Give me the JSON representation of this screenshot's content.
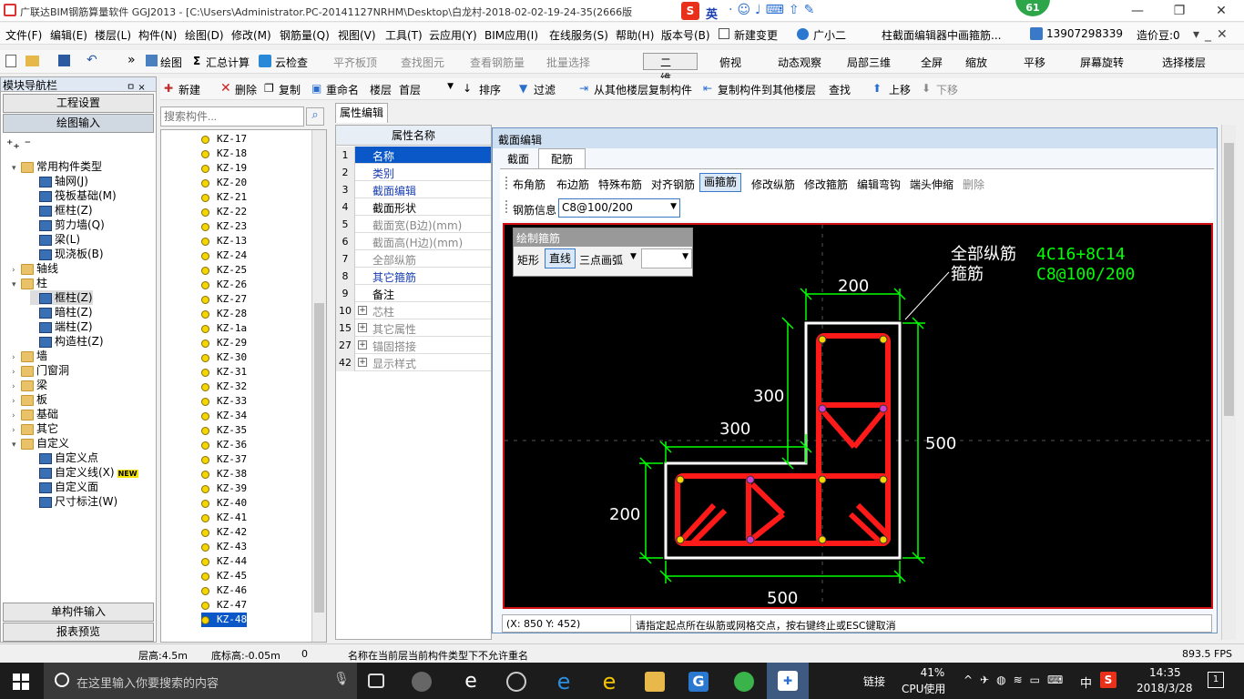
{
  "window": {
    "title": "广联达BIM钢筋算量软件 GGJ2013 - [C:\\Users\\Administrator.PC-20141127NRHM\\Desktop\\白龙村-2018-02-02-19-24-35(2666版",
    "ime_label": "英",
    "badge": "61",
    "min": "—",
    "max": "❐",
    "close": "✕"
  },
  "menu": [
    "文件(F)",
    "编辑(E)",
    "楼层(L)",
    "构件(N)",
    "绘图(D)",
    "修改(M)",
    "钢筋量(Q)",
    "视图(V)",
    "工具(T)",
    "云应用(Y)",
    "BIM应用(I)",
    "在线服务(S)",
    "帮助(H)",
    "版本号(B)",
    "新建变更",
    "广小二",
    "柱截面编辑器中画箍筋...",
    "13907298339",
    "造价豆:0"
  ],
  "toolbar1": {
    "draw": "绘图",
    "sum": "汇总计算",
    "cloud": "云检查",
    "flat": "平齐板顶",
    "find": "查找图元",
    "view_rebar": "查看钢筋量",
    "batch": "批量选择",
    "view_mode": "二维",
    "top_view": "俯视",
    "dynamic": "动态观察",
    "local3d": "局部三维",
    "fullscreen": "全屏",
    "zoom": "缩放",
    "pan": "平移",
    "rotate": "屏幕旋转",
    "sel_floor": "选择楼层"
  },
  "toolbar2": {
    "new": "新建",
    "delete": "删除",
    "copy": "复制",
    "rename": "重命名",
    "floor_label": "楼层",
    "floor_value": "首层",
    "sort": "排序",
    "filter": "过滤",
    "copy_from": "从其他楼层复制构件",
    "copy_to": "复制构件到其他楼层",
    "find": "查找",
    "up": "上移",
    "down": "下移"
  },
  "nav": {
    "header": "模块导航栏",
    "pin": "ㅁ ×",
    "setup": "工程设置",
    "draw_input": "绘图输入",
    "single": "单构件输入",
    "report": "报表预览",
    "tree": [
      {
        "exp": "▾",
        "icon": "folder",
        "label": "常用构件类型",
        "indent": 0
      },
      {
        "exp": "",
        "icon": "blue",
        "label": "轴网(J)",
        "indent": 2
      },
      {
        "exp": "",
        "icon": "blue",
        "label": "筏板基础(M)",
        "indent": 2
      },
      {
        "exp": "",
        "icon": "blue",
        "label": "框柱(Z)",
        "indent": 2
      },
      {
        "exp": "",
        "icon": "blue",
        "label": "剪力墙(Q)",
        "indent": 2
      },
      {
        "exp": "",
        "icon": "blue",
        "label": "梁(L)",
        "indent": 2
      },
      {
        "exp": "",
        "icon": "blue",
        "label": "现浇板(B)",
        "indent": 2
      },
      {
        "exp": "›",
        "icon": "folder",
        "label": "轴线",
        "indent": 0
      },
      {
        "exp": "▾",
        "icon": "folder",
        "label": "柱",
        "indent": 0
      },
      {
        "exp": "",
        "icon": "blue",
        "label": "框柱(Z)",
        "indent": 2,
        "sel": true
      },
      {
        "exp": "",
        "icon": "blue",
        "label": "暗柱(Z)",
        "indent": 2
      },
      {
        "exp": "",
        "icon": "blue",
        "label": "端柱(Z)",
        "indent": 2
      },
      {
        "exp": "",
        "icon": "blue",
        "label": "构造柱(Z)",
        "indent": 2
      },
      {
        "exp": "›",
        "icon": "folder",
        "label": "墙",
        "indent": 0
      },
      {
        "exp": "›",
        "icon": "folder",
        "label": "门窗洞",
        "indent": 0
      },
      {
        "exp": "›",
        "icon": "folder",
        "label": "梁",
        "indent": 0
      },
      {
        "exp": "›",
        "icon": "folder",
        "label": "板",
        "indent": 0
      },
      {
        "exp": "›",
        "icon": "folder",
        "label": "基础",
        "indent": 0
      },
      {
        "exp": "›",
        "icon": "folder",
        "label": "其它",
        "indent": 0
      },
      {
        "exp": "▾",
        "icon": "folder",
        "label": "自定义",
        "indent": 0
      },
      {
        "exp": "",
        "icon": "blue",
        "label": "自定义点",
        "indent": 2
      },
      {
        "exp": "",
        "icon": "blue",
        "label": "自定义线(X)",
        "indent": 2,
        "new": "NEW"
      },
      {
        "exp": "",
        "icon": "blue",
        "label": "自定义面",
        "indent": 2
      },
      {
        "exp": "",
        "icon": "blue",
        "label": "尺寸标注(W)",
        "indent": 2
      }
    ]
  },
  "search_placeholder": "搜索构件...",
  "components": [
    "KZ-17",
    "KZ-18",
    "KZ-19",
    "KZ-20",
    "KZ-21",
    "KZ-22",
    "KZ-23",
    "KZ-13",
    "KZ-24",
    "KZ-25",
    "KZ-26",
    "KZ-27",
    "KZ-28",
    "KZ-1a",
    "KZ-29",
    "KZ-30",
    "KZ-31",
    "KZ-32",
    "KZ-33",
    "KZ-34",
    "KZ-35",
    "KZ-36",
    "KZ-37",
    "KZ-38",
    "KZ-39",
    "KZ-40",
    "KZ-41",
    "KZ-42",
    "KZ-43",
    "KZ-44",
    "KZ-45",
    "KZ-46",
    "KZ-47",
    "KZ-48"
  ],
  "selected_component": "KZ-48",
  "props": {
    "tab": "属性编辑",
    "header": "属性名称",
    "rows": [
      {
        "num": "1",
        "label": "名称",
        "color": "#1a3fb0",
        "sel": true
      },
      {
        "num": "2",
        "label": "类别",
        "color": "#1a3fb0"
      },
      {
        "num": "3",
        "label": "截面编辑",
        "color": "#1a3fb0"
      },
      {
        "num": "4",
        "label": "截面形状",
        "color": "#000"
      },
      {
        "num": "5",
        "label": "截面宽(B边)(mm)",
        "color": "#888"
      },
      {
        "num": "6",
        "label": "截面高(H边)(mm)",
        "color": "#888"
      },
      {
        "num": "7",
        "label": "全部纵筋",
        "color": "#888"
      },
      {
        "num": "8",
        "label": "其它箍筋",
        "color": "#1a3fb0"
      },
      {
        "num": "9",
        "label": "备注",
        "color": "#000"
      },
      {
        "num": "10",
        "label": "芯柱",
        "color": "#888",
        "plus": true
      },
      {
        "num": "15",
        "label": "其它属性",
        "color": "#888",
        "plus": true
      },
      {
        "num": "27",
        "label": "锚固搭接",
        "color": "#888",
        "plus": true
      },
      {
        "num": "42",
        "label": "显示样式",
        "color": "#888",
        "plus": true
      }
    ]
  },
  "dialog": {
    "title": "截面编辑",
    "tabs": [
      "截面",
      "配筋"
    ],
    "tools": [
      "布角筋",
      "布边筋",
      "特殊布筋",
      "对齐钢筋",
      "画箍筋",
      "修改纵筋",
      "修改箍筋",
      "编辑弯钩",
      "端头伸缩",
      "删除"
    ],
    "rebar_label": "钢筋信息",
    "rebar_value": "C8@100/200",
    "draw_panel": {
      "title": "绘制箍筋",
      "rect": "矩形",
      "line": "直线",
      "arc": "三点画弧"
    },
    "canvas": {
      "label_long": "全部纵筋",
      "long_value": "4C16+8C14",
      "label_stirrup": "箍筋",
      "stirrup_value": "C8@100/200",
      "dims": {
        "top": "200",
        "left_upper": "300",
        "mid": "300",
        "right": "500",
        "left_lower": "200",
        "bottom": "500"
      }
    },
    "coords": "(X: 850 Y: 452)",
    "hint": "请指定起点所在纵筋或网格交点，按右键终止或ESC键取消"
  },
  "status": {
    "floor_height": "层高:4.5m",
    "base_height": "底标高:-0.05m",
    "zero": "0",
    "msg": "名称在当前层当前构件类型下不允许重名",
    "fps": "893.5 FPS"
  },
  "taskbar": {
    "search": "在这里输入你要搜索的内容",
    "link": "链接",
    "cpu": "41%",
    "cpu_label": "CPU使用",
    "time": "14:35",
    "date": "2018/3/28",
    "lang": "中",
    "notify": "1"
  },
  "colors": {
    "rebar": "#ff1a1a",
    "dim": "#00ff00",
    "outline": "#ffffff",
    "accent": "#0a58c8"
  }
}
